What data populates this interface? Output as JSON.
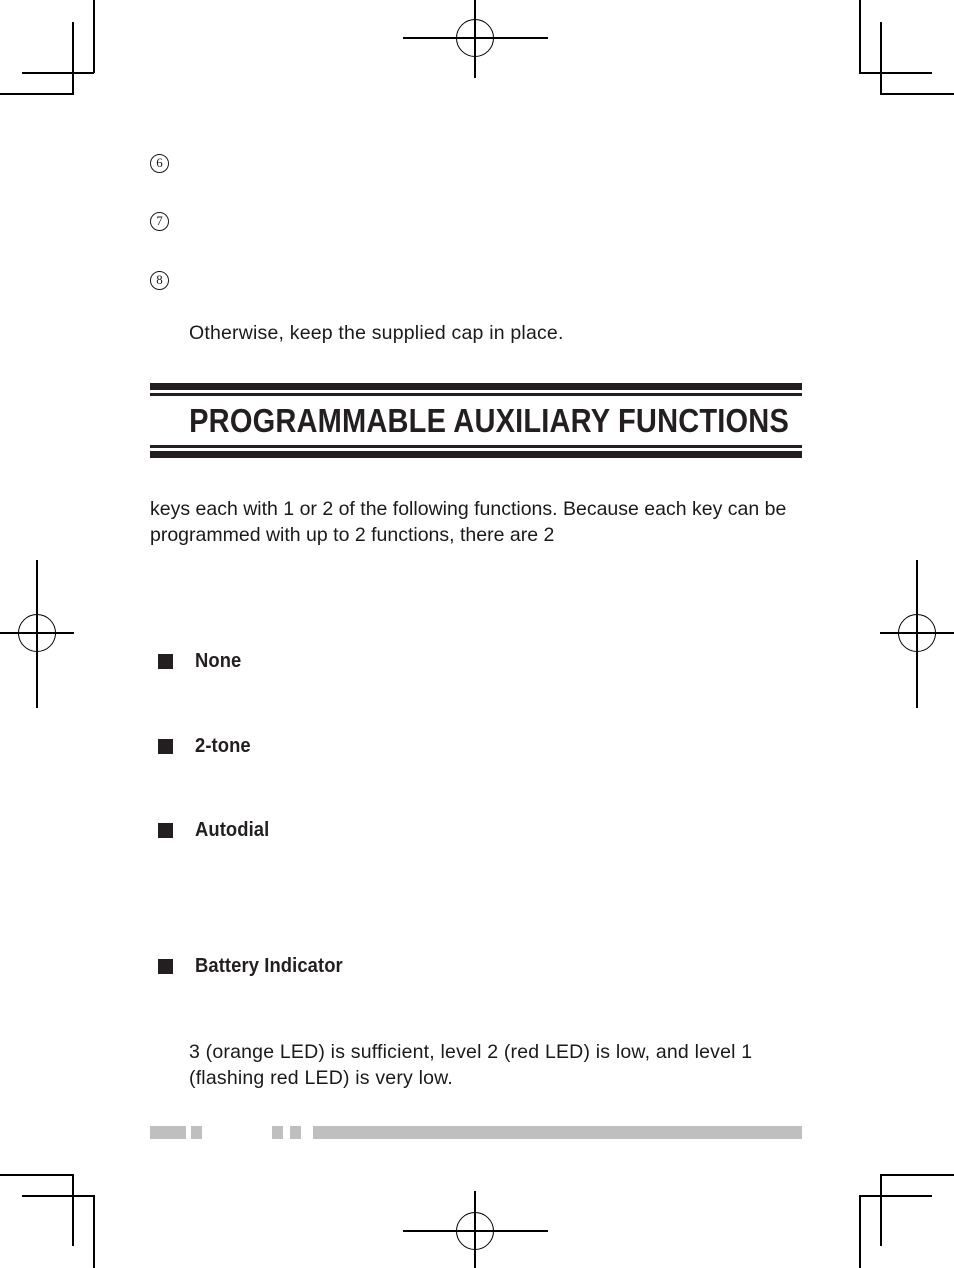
{
  "page": {
    "numbered_items": [
      {
        "number": "6",
        "glyph": "6"
      },
      {
        "number": "7",
        "glyph": "7"
      },
      {
        "number": "8",
        "glyph": "8"
      }
    ],
    "note_line": "Otherwise, keep the supplied cap in place.",
    "section_title": "PROGRAMMABLE AUXILIARY FUNCTIONS",
    "intro_paragraph": "keys each with 1 or 2 of the following functions.  Because each key can be programmed with up to 2 functions, there are 2",
    "function_headings": [
      {
        "label": "None"
      },
      {
        "label": "2-tone"
      },
      {
        "label": "Autodial"
      },
      {
        "label": "Battery Indicator"
      }
    ],
    "battery_paragraph": "3 (orange LED) is sufficient, level 2 (red LED) is low, and level 1 (flashing red LED) is very low."
  },
  "colors": {
    "ink": "#231f20",
    "footer_gray": "#bfbfbf",
    "paper": "#ffffff"
  }
}
